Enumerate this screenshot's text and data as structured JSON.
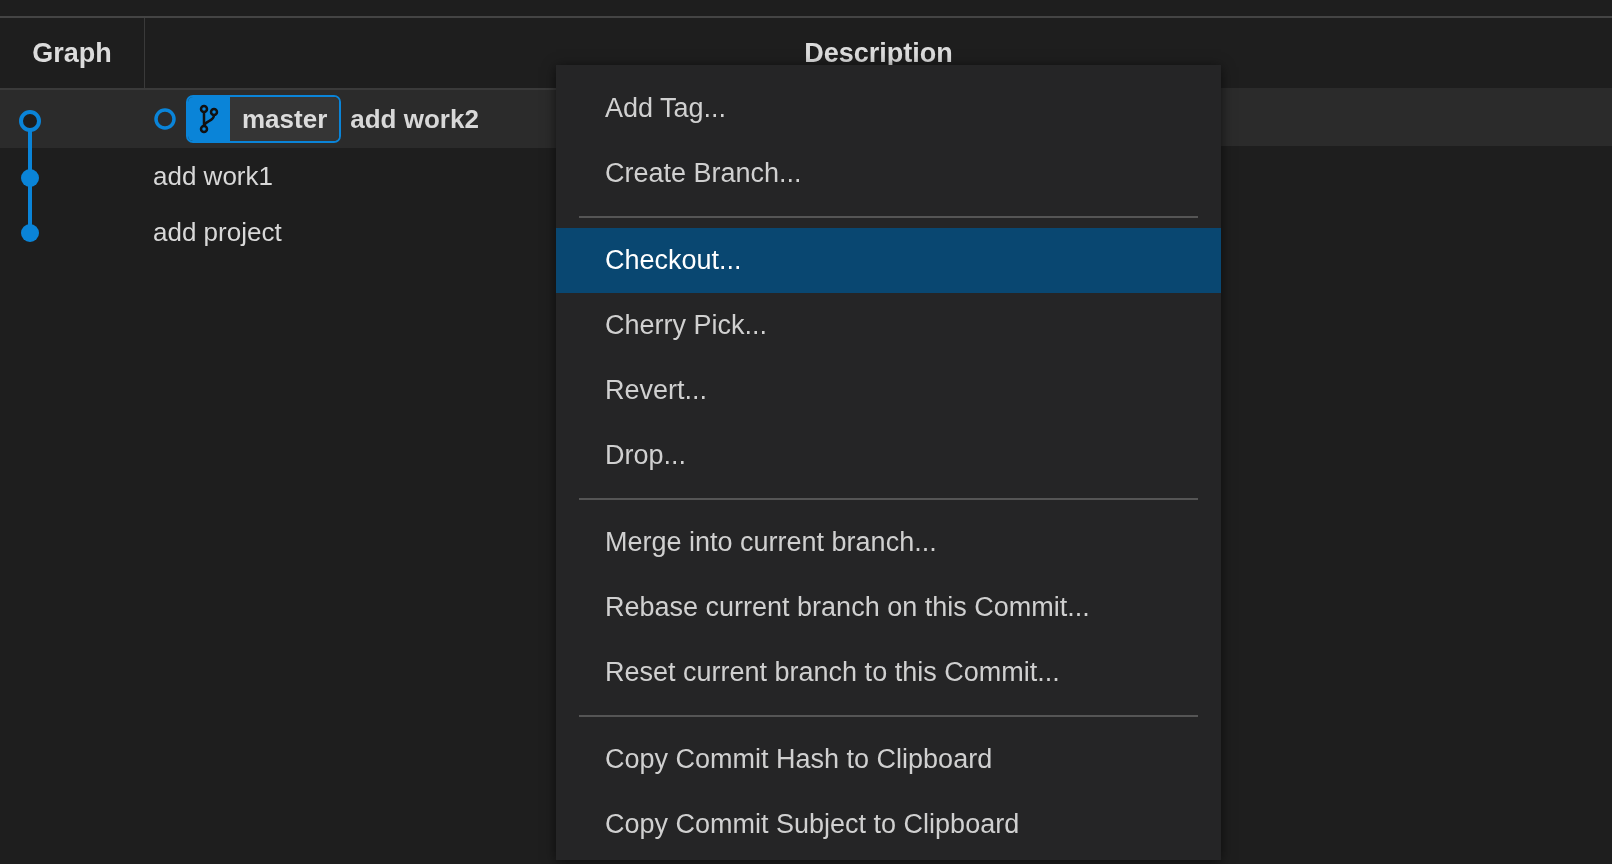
{
  "table": {
    "columns": [
      {
        "label": "Graph"
      },
      {
        "label": "Description"
      }
    ],
    "rows": [
      {
        "selected": true,
        "head": true,
        "branch": "master",
        "message": "add work2"
      },
      {
        "selected": false,
        "head": false,
        "message": "add work1"
      },
      {
        "selected": false,
        "head": false,
        "message": "add project"
      }
    ]
  },
  "context_menu": {
    "items": [
      {
        "kind": "item",
        "label": "Add Tag...",
        "selected": false
      },
      {
        "kind": "item",
        "label": "Create Branch...",
        "selected": false
      },
      {
        "kind": "separator"
      },
      {
        "kind": "item",
        "label": "Checkout...",
        "selected": true
      },
      {
        "kind": "item",
        "label": "Cherry Pick...",
        "selected": false
      },
      {
        "kind": "item",
        "label": "Revert...",
        "selected": false
      },
      {
        "kind": "item",
        "label": "Drop...",
        "selected": false
      },
      {
        "kind": "separator"
      },
      {
        "kind": "item",
        "label": "Merge into current branch...",
        "selected": false
      },
      {
        "kind": "item",
        "label": "Rebase current branch on this Commit...",
        "selected": false
      },
      {
        "kind": "item",
        "label": "Reset current branch to this Commit...",
        "selected": false
      },
      {
        "kind": "separator"
      },
      {
        "kind": "item",
        "label": "Copy Commit Hash to Clipboard",
        "selected": false
      },
      {
        "kind": "item",
        "label": "Copy Commit Subject to Clipboard",
        "selected": false
      }
    ]
  }
}
